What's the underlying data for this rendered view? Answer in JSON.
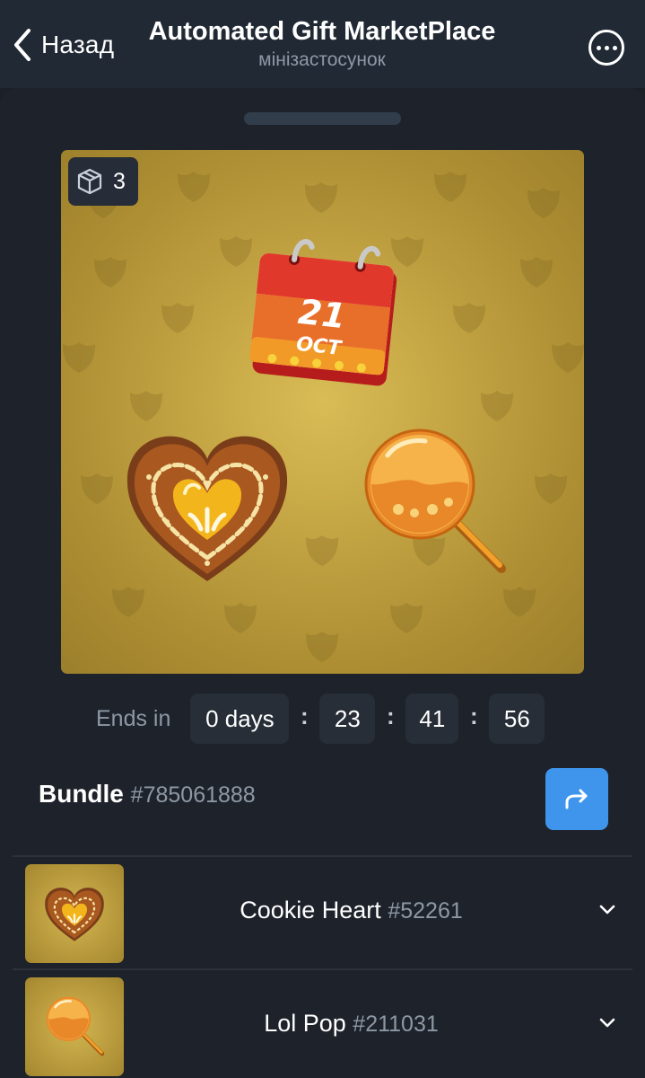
{
  "header": {
    "back_label": "Назад",
    "title": "Automated Gift MarketPlace",
    "subtitle": "мінізастосунок",
    "more_icon": "ellipsis-circle-icon"
  },
  "preview": {
    "item_count": "3",
    "count_icon": "box-icon",
    "calendar_day": "21",
    "calendar_month": "OCT",
    "background_color": "#c2a443"
  },
  "countdown": {
    "label": "Ends in",
    "days": "0 days",
    "hours": "23",
    "minutes": "41",
    "seconds": "56",
    "separator": ":"
  },
  "bundle": {
    "title": "Bundle",
    "number": "#785061888",
    "share_icon": "share-arrow-icon"
  },
  "items": [
    {
      "name": "Cookie Heart",
      "number": "#52261",
      "icon": "cookie-heart-icon"
    },
    {
      "name": "Lol Pop",
      "number": "#211031",
      "icon": "lollipop-icon"
    }
  ],
  "colors": {
    "header_bg": "#212934",
    "sheet_bg": "#1e232b",
    "accent": "#3f95ec",
    "muted_text": "#8e98a5"
  }
}
